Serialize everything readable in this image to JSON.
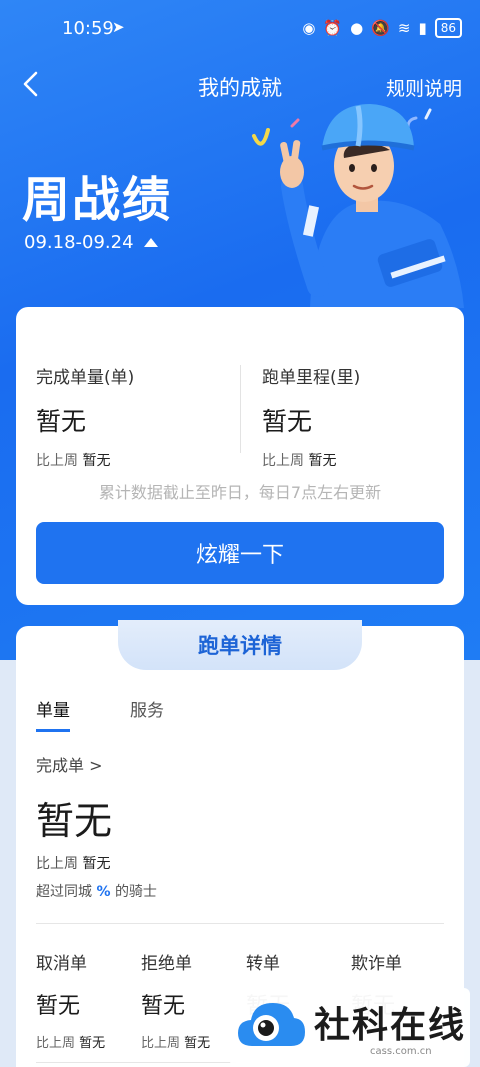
{
  "status_bar": {
    "time": "10:59",
    "battery": "86"
  },
  "nav": {
    "title": "我的成就",
    "rules_label": "规则说明"
  },
  "hero": {
    "title": "周战绩",
    "date_range": "09.18-09.24"
  },
  "summary_card": {
    "stats": [
      {
        "label": "完成单量(单)",
        "value": "暂无",
        "compare_prefix": "比上周",
        "compare_value": "暂无"
      },
      {
        "label": "跑单里程(里)",
        "value": "暂无",
        "compare_prefix": "比上周",
        "compare_value": "暂无"
      }
    ],
    "note": "累计数据截止至昨日，每日7点左右更新",
    "button_label": "炫耀一下"
  },
  "detail_card": {
    "header": "跑单详情",
    "tabs": [
      "单量",
      "服务"
    ],
    "active_tab": "单量",
    "completed_link": "完成单 >",
    "completed_value": "暂无",
    "compare_prefix": "比上周",
    "compare_value": "暂无",
    "exceed_prefix": "超过同城",
    "exceed_pct": "%",
    "exceed_suffix": "的骑士",
    "items": [
      {
        "label": "取消单",
        "value": "暂无",
        "compare_prefix": "比上周",
        "compare_value": "暂无"
      },
      {
        "label": "拒绝单",
        "value": "暂无",
        "compare_prefix": "比上周",
        "compare_value": "暂无"
      },
      {
        "label": "转单",
        "value": "暂无",
        "compare_prefix": "",
        "compare_value": ""
      },
      {
        "label": "欺诈单",
        "value": "暂无",
        "compare_prefix": "",
        "compare_value": ""
      }
    ]
  },
  "watermark": {
    "text": "社科在线",
    "sub": "cass.com.cn"
  },
  "colors": {
    "primary": "#1f73f0",
    "hero_top": "#2f86f6"
  }
}
